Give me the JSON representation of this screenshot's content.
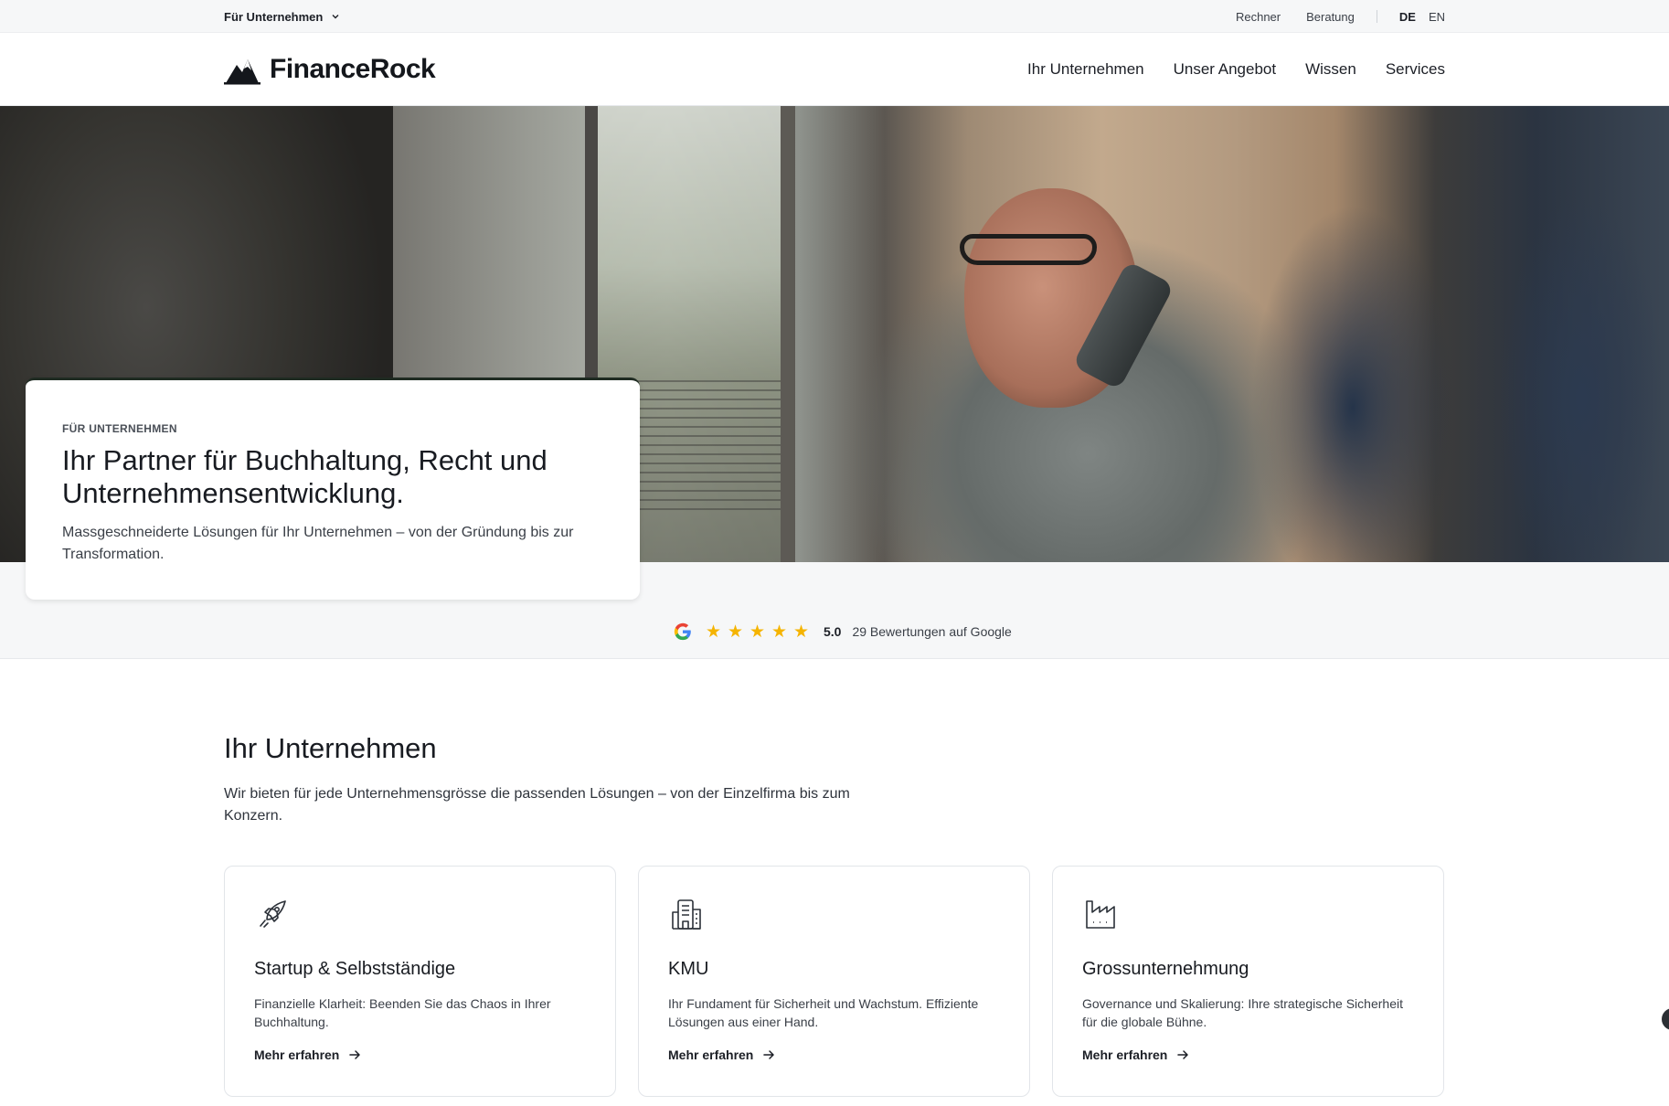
{
  "utility_bar": {
    "audience_label": "Für Unternehmen",
    "links": [
      "Rechner",
      "Beratung"
    ],
    "languages": [
      "DE",
      "EN"
    ],
    "active_language": "DE"
  },
  "nav": {
    "brand": "FinanceRock",
    "items": [
      "Ihr Unternehmen",
      "Unser Angebot",
      "Wissen",
      "Services"
    ]
  },
  "hero": {
    "eyebrow": "FÜR UNTERNEHMEN",
    "title": "Ihr Partner für Buchhaltung, Recht und Unternehmensentwicklung.",
    "subtitle": "Massgeschneiderte Lösungen für Ihr Unternehmen – von der Gründung bis zur Transformation."
  },
  "rating": {
    "icon": "google-icon",
    "stars": 5,
    "score": "5.0",
    "reviews_text": "29 Bewertungen auf Google",
    "star_color": "#f5b400"
  },
  "section": {
    "title": "Ihr Unternehmen",
    "lead": "Wir bieten für jede Unternehmensgrösse die passenden Lösungen – von der Einzelfirma bis zum Konzern.",
    "cards": [
      {
        "icon": "rocket-icon",
        "title": "Startup & Selbstständige",
        "description": "Finanzielle Klarheit: Beenden Sie das Chaos in Ihrer Buchhaltung.",
        "link": "Mehr erfahren"
      },
      {
        "icon": "building-icon",
        "title": "KMU",
        "description": "Ihr Fundament für Sicherheit und Wachstum. Effiziente Lösungen aus einer Hand.",
        "link": "Mehr erfahren"
      },
      {
        "icon": "factory-icon",
        "title": "Grossunternehmung",
        "description": "Governance und Skalierung: Ihre strategische Sicherheit für die globale Bühne.",
        "link": "Mehr erfahren"
      }
    ]
  }
}
